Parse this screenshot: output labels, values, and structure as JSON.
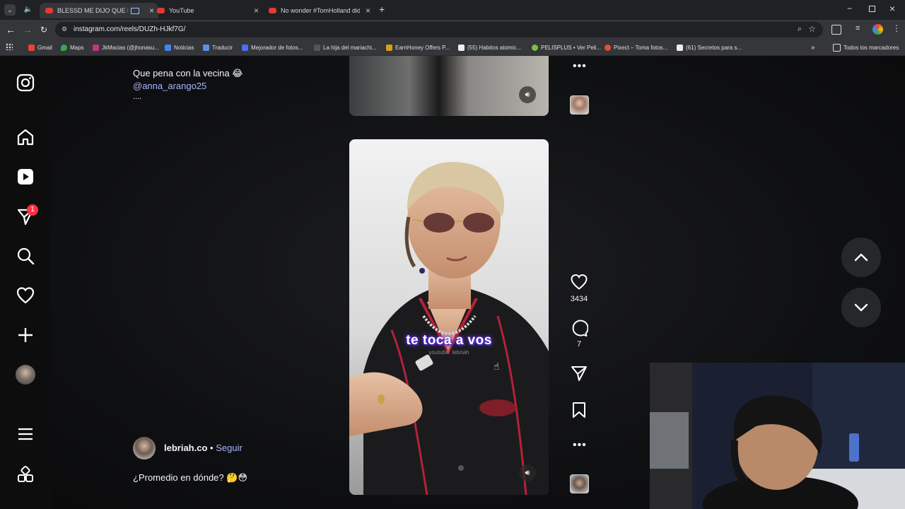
{
  "browser": {
    "tabs": [
      {
        "title": "BLESSD ME DIJO QUE LE PI"
      },
      {
        "title": "YouTube"
      },
      {
        "title": "No wonder #TomHolland didn't"
      }
    ],
    "url": "instagram.com/reels/DUZh-HJkf7G/",
    "bookmarks": [
      "Gmail",
      "Maps",
      "JkMacias (@jhonasu...",
      "Noticias",
      "Traducir",
      "Mejorador de fotos...",
      "La hija del mariachi...",
      "EarnHoney Offers P...",
      "(55) Habitos atomic...",
      "PELISPLUS • Ver Peli...",
      "Pixect – Toma fotos...",
      "(61) Secretos para s..."
    ],
    "all_bookmarks": "Todos los marcadores"
  },
  "nav": {
    "notifications_badge": "1"
  },
  "prev_reel": {
    "caption": "Que pena con la vecina 😂",
    "mention": "@anna_arango25",
    "more": "...."
  },
  "reel": {
    "overlay_text": "te toca a vos",
    "watermark": "youtube: lebriah",
    "author": "lebriah.co",
    "dot": "•",
    "follow": "Seguir",
    "caption": "¿Promedio en dónde? 🤔😳",
    "likes": "3434",
    "comments": "7"
  },
  "colors": {
    "accent_link": "#a8b5ff",
    "badge": "#ff3040"
  }
}
